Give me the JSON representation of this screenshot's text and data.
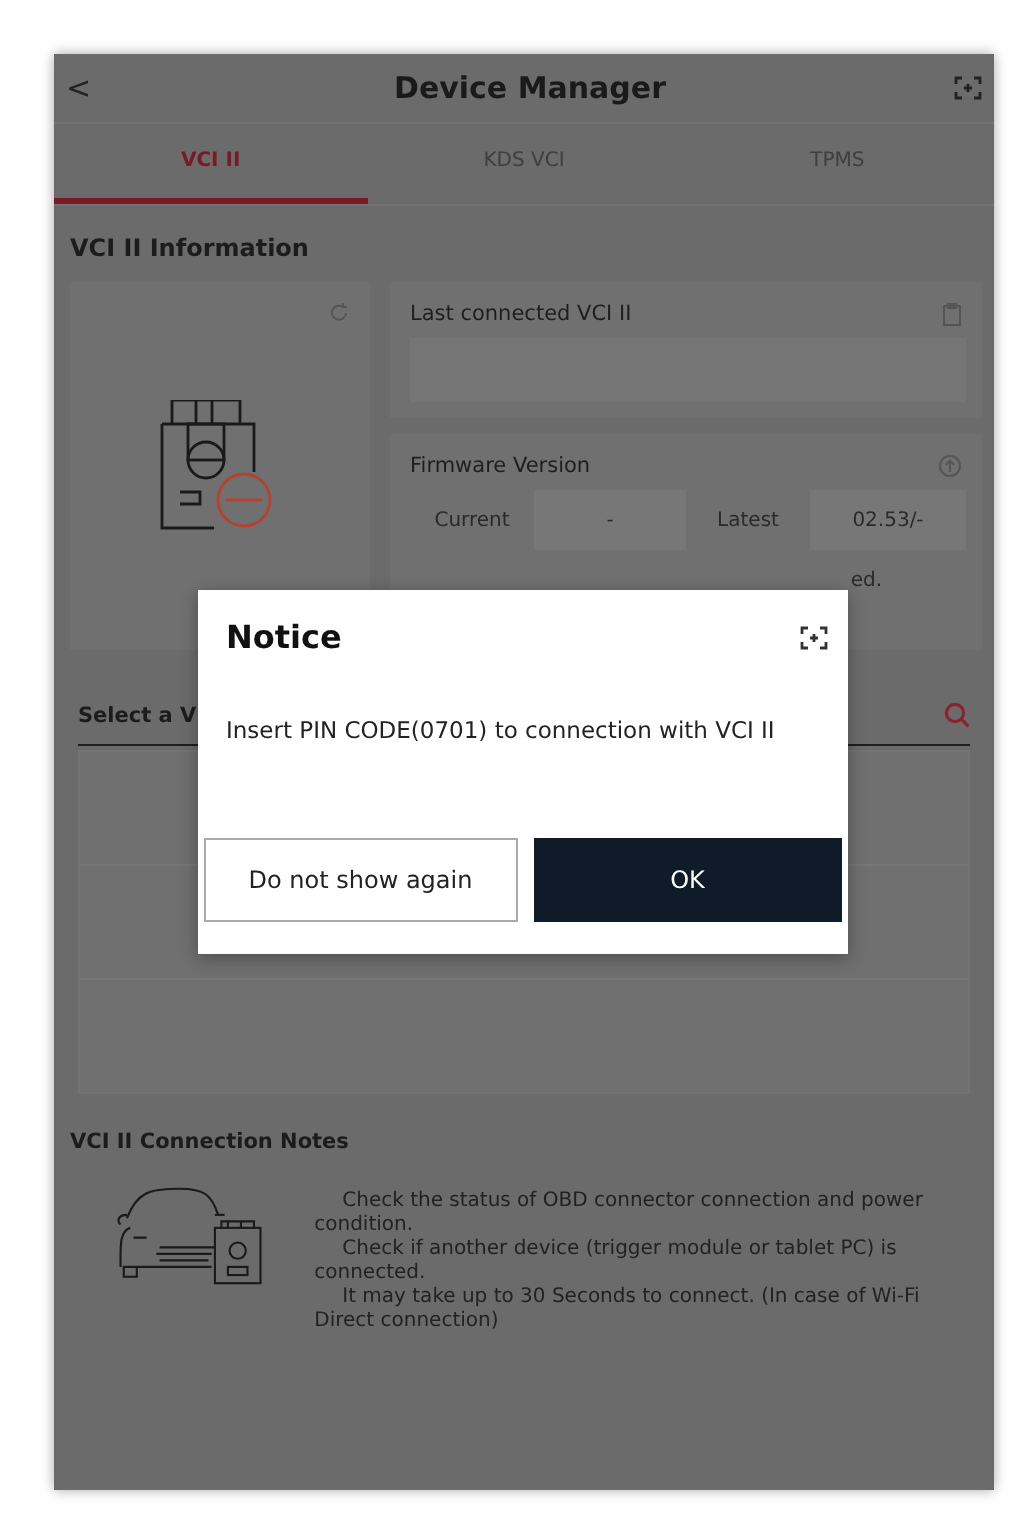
{
  "header": {
    "back": "<",
    "title": "Device Manager"
  },
  "tabs": [
    {
      "label": "VCI II",
      "selected": true
    },
    {
      "label": "KDS VCI",
      "selected": false
    },
    {
      "label": "TPMS",
      "selected": false
    }
  ],
  "info": {
    "title": "VCI II Information",
    "last_connected": {
      "label": "Last connected VCI II"
    },
    "firmware": {
      "label": "Firmware Version",
      "current_label": "Current",
      "current_value": "-",
      "latest_label": "Latest",
      "latest_value": "02.53/-",
      "note": "ed."
    }
  },
  "select": {
    "title": "Select a V"
  },
  "notes": {
    "title": "VCI II Connection Notes",
    "lines": [
      "Check the status of OBD connector connection and power condition.",
      "Check if another device (trigger module or tablet PC) is connected.",
      "It may take up to 30 Seconds to connect. (In case of Wi-Fi Direct connection)"
    ]
  },
  "dialog": {
    "title": "Notice",
    "message": "Insert PIN CODE(0701) to connection with VCI II",
    "buttons": [
      {
        "label": "Do not show again",
        "kind": "secondary"
      },
      {
        "label": "OK",
        "kind": "primary"
      }
    ]
  }
}
